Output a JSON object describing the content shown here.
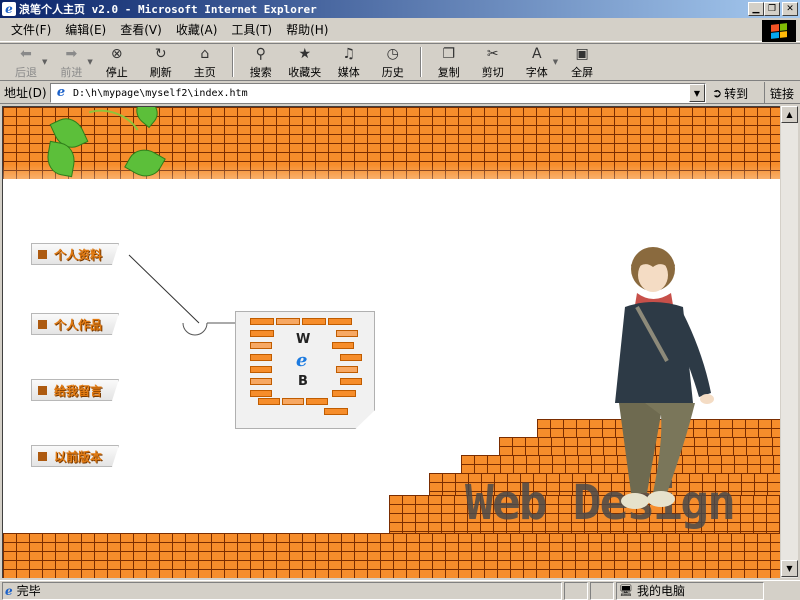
{
  "window": {
    "title": "浪笔个人主页 v2.0 - Microsoft Internet Explorer"
  },
  "menu": [
    {
      "label": "文件(F)"
    },
    {
      "label": "编辑(E)"
    },
    {
      "label": "查看(V)"
    },
    {
      "label": "收藏(A)"
    },
    {
      "label": "工具(T)"
    },
    {
      "label": "帮助(H)"
    }
  ],
  "toolbar": {
    "back": "后退",
    "forward": "前进",
    "stop": "停止",
    "refresh": "刷新",
    "home": "主页",
    "search": "搜索",
    "favorites": "收藏夹",
    "media": "媒体",
    "history": "历史",
    "copy": "复制",
    "cut": "剪切",
    "font": "字体",
    "fullscreen": "全屏"
  },
  "address": {
    "label": "地址(D)",
    "url": "D:\\h\\mypage\\myself2\\index.htm",
    "go": "转到",
    "links": "链接"
  },
  "page": {
    "nav": [
      {
        "label": "个人资料"
      },
      {
        "label": "个人作品"
      },
      {
        "label": "给我留言"
      },
      {
        "label": "以前版本"
      }
    ],
    "web_letters": [
      "W",
      "e",
      "B"
    ],
    "wordmark": "Web Design"
  },
  "status": {
    "text": "完毕",
    "zone": "我的电脑"
  },
  "colors": {
    "brick": "#f68d2b",
    "mortar": "#7a2d00",
    "nav_text": "#e27b12",
    "titlebar": "#0a246a"
  }
}
